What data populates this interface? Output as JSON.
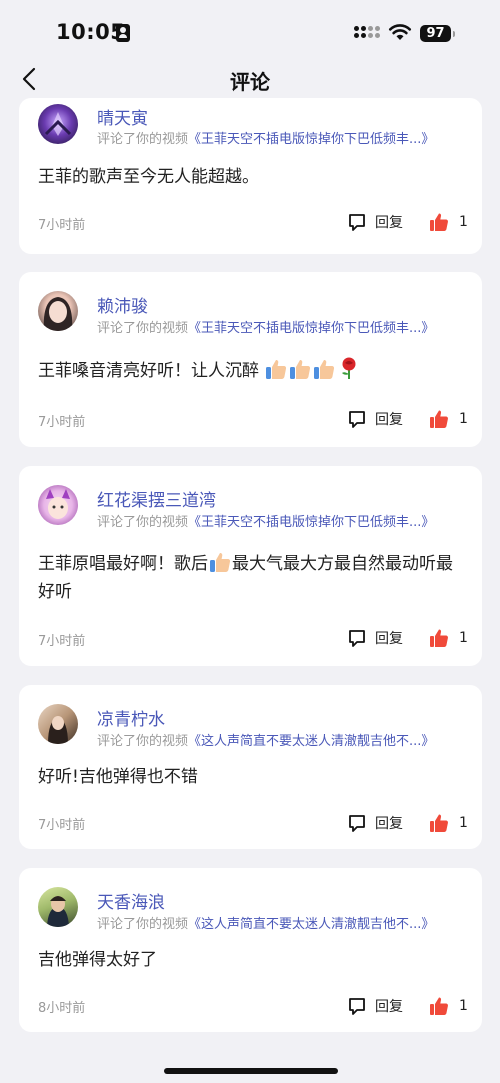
{
  "status_bar": {
    "time": "10:05",
    "battery": "97",
    "icons": [
      "id-card-icon",
      "signal-icon",
      "wifi-icon",
      "battery-icon"
    ]
  },
  "nav": {
    "title": "评论",
    "back_icon": "chevron-left-icon"
  },
  "comments": [
    {
      "username": "晴天寅",
      "action": "评论了你的视频",
      "video_title": "《王菲天空不插电版惊掉你下巴低频丰...》",
      "text": "王菲的歌声至今无人能超越。",
      "time": "7小时前",
      "reply_label": "回复",
      "likes": "1"
    },
    {
      "username": "赖沛骏",
      "action": "评论了你的视频",
      "video_title": "《王菲天空不插电版惊掉你下巴低频丰...》",
      "text": "王菲嗓音清亮好听！让人沉醉",
      "emoji": [
        "thumbs-up",
        "thumbs-up",
        "thumbs-up",
        "rose"
      ],
      "time": "7小时前",
      "reply_label": "回复",
      "likes": "1"
    },
    {
      "username": "红花渠摆三道湾",
      "action": "评论了你的视频",
      "video_title": "《王菲天空不插电版惊掉你下巴低频丰...》",
      "text_a": "王菲原唱最好啊！歌后",
      "text_b": "最大气最大方最自然最动听最好听",
      "emoji": [
        "thumbs-up"
      ],
      "time": "7小时前",
      "reply_label": "回复",
      "likes": "1"
    },
    {
      "username": "凉青柠水",
      "action": "评论了你的视频",
      "video_title": "《这人声简直不要太迷人清澈靓吉他不...》",
      "text": "好听!吉他弹得也不错",
      "time": "7小时前",
      "reply_label": "回复",
      "likes": "1"
    },
    {
      "username": "天香海浪",
      "action": "评论了你的视频",
      "video_title": "《这人声简直不要太迷人清澈靓吉他不...》",
      "text": "吉他弹得太好了",
      "time": "8小时前",
      "reply_label": "回复",
      "likes": "1"
    }
  ],
  "colors": {
    "background": "#f1f1f5",
    "card": "#ffffff",
    "username": "#4a58b8",
    "link": "#4a58b8",
    "secondary_text": "#9a9a9a",
    "like_icon": "#f04a3a"
  }
}
